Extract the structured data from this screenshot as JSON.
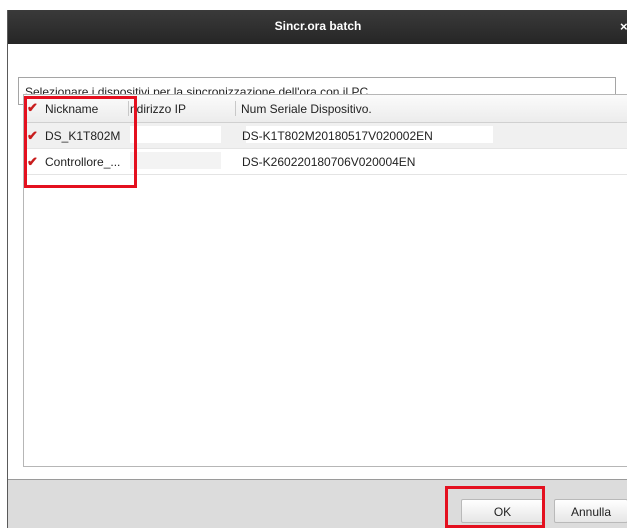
{
  "dialog": {
    "title": "Sincr.ora batch",
    "close_glyph": "×",
    "instruction": "Selezionare i dispositivi per la sincronizzazione dell'ora con il PC"
  },
  "table": {
    "headers": {
      "nickname": "Nickname",
      "ip": "ndirizzo IP",
      "serial": "Num Seriale Dispositivo."
    },
    "header_checked": true,
    "rows": [
      {
        "checked": true,
        "nickname": "DS_K1T802M",
        "ip": "",
        "serial": "DS-K1T802M20180517V020002EN"
      },
      {
        "checked": true,
        "nickname": "Controllore_...",
        "ip": "",
        "serial": "DS-K260220180706V020004EN"
      }
    ]
  },
  "footer": {
    "ok_label": "OK",
    "cancel_label": "Annulla"
  },
  "colors": {
    "highlight": "#e4101f",
    "checkmark": "#c81d1d",
    "titlebar": "#2b2b2b"
  },
  "icons": {
    "checkbox": "checkmark-icon",
    "close": "close-icon"
  }
}
